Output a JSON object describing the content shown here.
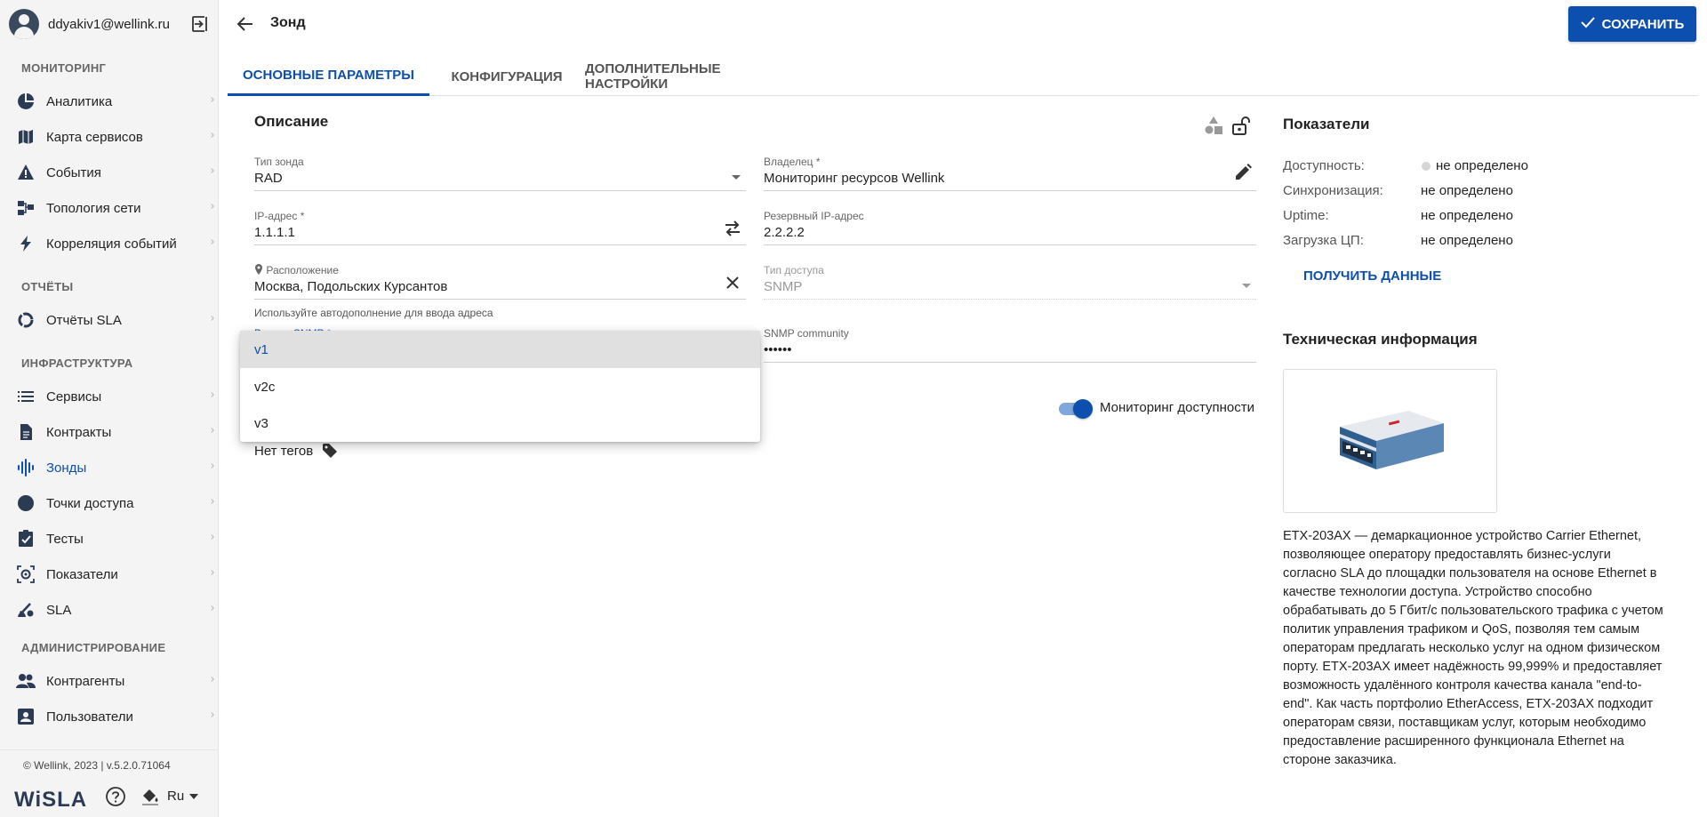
{
  "user": {
    "email": "ddyakiv1@wellink.ru"
  },
  "sidebar": {
    "sections": {
      "monitoring": "МОНИТОРИНГ",
      "reports": "ОТЧЁТЫ",
      "infrastructure": "ИНФРАСТРУКТУРА",
      "administration": "АДМИНИСТРИРОВАНИЕ"
    },
    "items": {
      "analytics": "Аналитика",
      "service_map": "Карта сервисов",
      "events": "События",
      "topology": "Топология сети",
      "correlation": "Корреляция событий",
      "sla_reports": "Отчёты SLA",
      "services": "Сервисы",
      "contracts": "Контракты",
      "probes": "Зонды",
      "access_points": "Точки доступа",
      "tests": "Тесты",
      "metrics": "Показатели",
      "sla": "SLA",
      "contractors": "Контрагенты",
      "users": "Пользователи"
    },
    "footer": {
      "copyright": "© Wellink, 2023 | v.5.2.0.71064",
      "brand": "WiSLA",
      "language": "Ru"
    }
  },
  "header": {
    "title": "Зонд",
    "save_label": "СОХРАНИТЬ"
  },
  "tabs": {
    "main": "ОСНОВНЫЕ ПАРАМЕТРЫ",
    "config": "КОНФИГУРАЦИЯ",
    "advanced": "ДОПОЛНИТЕЛЬНЫЕ НАСТРОЙКИ"
  },
  "form": {
    "section_title": "Описание",
    "probe_type": {
      "label": "Тип зонда",
      "value": "RAD"
    },
    "owner": {
      "label": "Владелец *",
      "value": "Мониторинг ресурсов Wellink"
    },
    "ip": {
      "label": "IP-адрес *",
      "value": "1.1.1.1"
    },
    "backup_ip": {
      "label": "Резервный IP-адрес",
      "value": "2.2.2.2"
    },
    "location": {
      "label": "Расположение",
      "value": "Москва, Подольских Курсантов",
      "helper": "Используйте автодополнение для ввода адреса"
    },
    "access_type": {
      "label": "Тип доступа",
      "value": "SNMP"
    },
    "snmp_version": {
      "label": "Версия SNMP *"
    },
    "snmp_community": {
      "label": "SNMP community",
      "value": "••••••"
    },
    "availability_monitoring": "Мониторинг доступности",
    "tags": "Нет тегов"
  },
  "dropdown": {
    "options": [
      "v1",
      "v2c",
      "v3"
    ],
    "selected": "v1"
  },
  "metrics": {
    "title": "Показатели",
    "availability": {
      "label": "Доступность:",
      "value": "не определено"
    },
    "sync": {
      "label": "Синхронизация:",
      "value": "не определено"
    },
    "uptime": {
      "label": "Uptime:",
      "value": "не определено"
    },
    "cpu": {
      "label": "Загрузка ЦП:",
      "value": "не определено"
    },
    "get_data": "ПОЛУЧИТЬ ДАННЫЕ"
  },
  "tech": {
    "title": "Техническая информация",
    "description": "ETX-203AX — демаркационное устройство Carrier Ethernet, позволяющее оператору предоставлять бизнес-услуги согласно SLA до площадки пользователя на основе Ethernet в качестве технологии доступа. Устройство способно обрабатывать до 5 Гбит/с пользовательского трафика с учетом политик управления трафиком и QoS, позволяя тем самым операторам предлагать несколько услуг на одном физическом порту. ETX-203AX имеет надёжность 99,999% и предоставляет возможность удалённого контроля качества канала \"end-to-end\". Как часть портфолио EtherAccess, ETX-203AX подходит операторам связи, поставщикам услуг, которым необходимо предоставление расширенного функционала Ethernet на стороне заказчика."
  },
  "colors": {
    "accent": "#0d4fae",
    "sidebar_bg": "#f4f4f4",
    "dropdown_selected_bg": "#e0e0e0"
  }
}
